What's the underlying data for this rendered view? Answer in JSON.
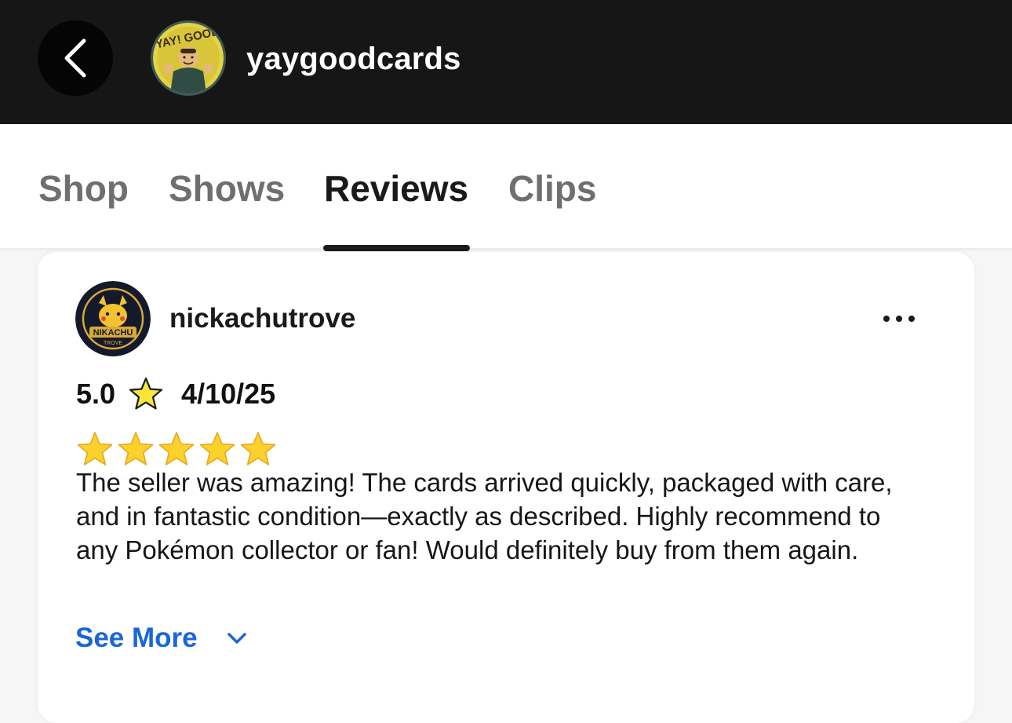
{
  "header": {
    "shop_name": "yaygoodcards",
    "back_icon": "chevron-left-icon",
    "avatar_logo_text": "YAY! GOOD"
  },
  "tabs": [
    {
      "label": "Shop",
      "active": false
    },
    {
      "label": "Shows",
      "active": false
    },
    {
      "label": "Reviews",
      "active": true
    },
    {
      "label": "Clips",
      "active": false
    }
  ],
  "review": {
    "reviewer_name": "nickachutrove",
    "reviewer_logo_text": "NIKACHU",
    "reviewer_logo_subtext": "TROVE",
    "rating": "5.0",
    "date": "4/10/25",
    "stars": 5,
    "text": "The seller was amazing! The cards arrived quickly, packaged with care, and in fantastic condition—exactly as described. Highly recommend to any Pokémon collector or fan! Would definitely buy from them again.",
    "see_more_label": "See More"
  },
  "colors": {
    "header_bg": "#161616",
    "link_blue": "#1a66d9",
    "star_gold": "#f5c518"
  }
}
